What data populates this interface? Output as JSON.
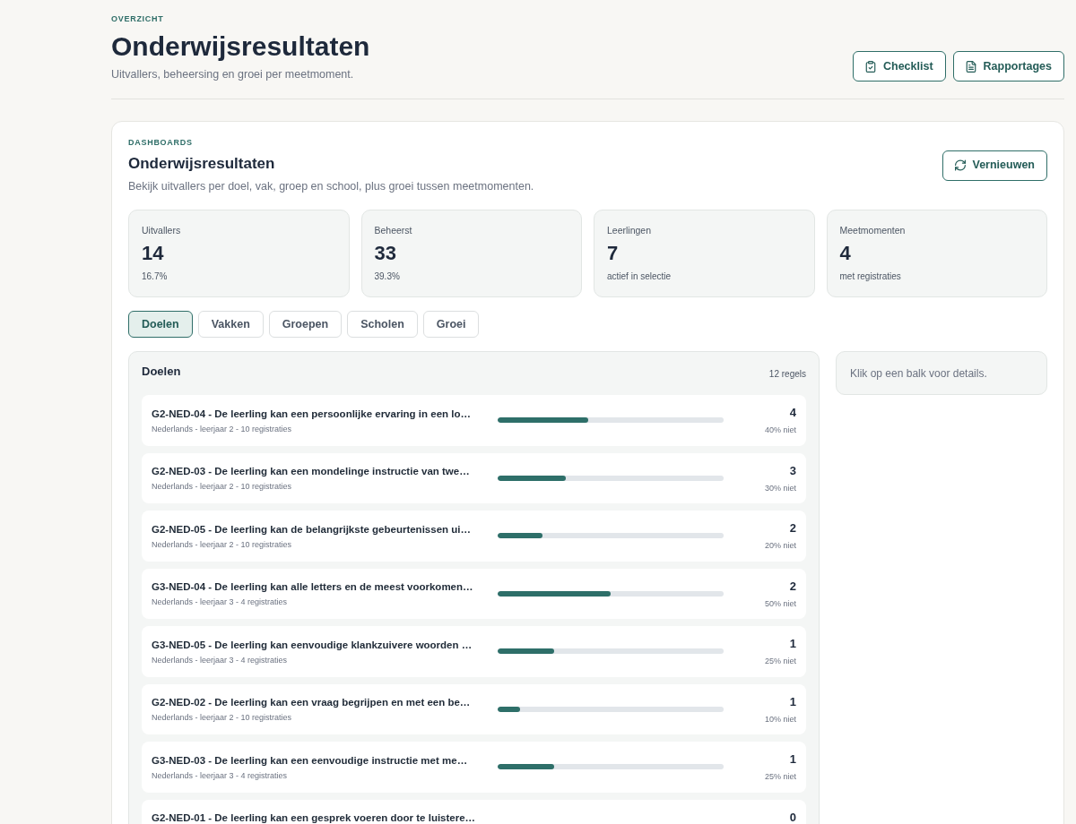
{
  "header": {
    "eyebrow": "OVERZICHT",
    "title": "Onderwijsresultaten",
    "subtitle": "Uitvallers, beheersing en groei per meetmoment.",
    "actions": [
      {
        "label": "Checklist"
      },
      {
        "label": "Rapportages"
      }
    ]
  },
  "dashboard": {
    "eyebrow": "DASHBOARDS",
    "title": "Onderwijsresultaten",
    "description": "Bekijk uitvallers per doel, vak, groep en school, plus groei tussen meetmomenten.",
    "refresh_button": {
      "label": "Vernieuwen"
    }
  },
  "stats": [
    {
      "label": "Uitvallers",
      "value": "14",
      "note": "16.7%"
    },
    {
      "label": "Beheerst",
      "value": "33",
      "note": "39.3%"
    },
    {
      "label": "Leerlingen",
      "value": "7",
      "note": "actief in selectie"
    },
    {
      "label": "Meetmomenten",
      "value": "4",
      "note": "met registraties"
    }
  ],
  "tabs": [
    {
      "label": "Doelen",
      "selected": true
    },
    {
      "label": "Vakken",
      "selected": false
    },
    {
      "label": "Groepen",
      "selected": false
    },
    {
      "label": "Scholen",
      "selected": false
    },
    {
      "label": "Groei",
      "selected": false
    }
  ],
  "list": {
    "title": "Doelen",
    "count": "12 regels",
    "rows": [
      {
        "title": "G2-NED-04 - De leerling kan een persoonlijke ervaring in een lo…",
        "meta": "Nederlands - leerjaar 2 - 10 registraties",
        "level": 0.4,
        "count": "4",
        "share": "40% niet"
      },
      {
        "title": "G2-NED-03 - De leerling kan een mondelinge instructie van twe…",
        "meta": "Nederlands - leerjaar 2 - 10 registraties",
        "level": 0.3,
        "count": "3",
        "share": "30% niet"
      },
      {
        "title": "G2-NED-05 - De leerling kan de belangrijkste gebeurtenissen ui…",
        "meta": "Nederlands - leerjaar 2 - 10 registraties",
        "level": 0.2,
        "count": "2",
        "share": "20% niet"
      },
      {
        "title": "G3-NED-04 - De leerling kan alle letters en de meest voorkomen…",
        "meta": "Nederlands - leerjaar 3 - 4 registraties",
        "level": 0.5,
        "count": "2",
        "share": "50% niet"
      },
      {
        "title": "G3-NED-05 - De leerling kan eenvoudige klankzuivere woorden …",
        "meta": "Nederlands - leerjaar 3 - 4 registraties",
        "level": 0.25,
        "count": "1",
        "share": "25% niet"
      },
      {
        "title": "G2-NED-02 - De leerling kan een vraag begrijpen en met een be…",
        "meta": "Nederlands - leerjaar 2 - 10 registraties",
        "level": 0.1,
        "count": "1",
        "share": "10% niet"
      },
      {
        "title": "G3-NED-03 - De leerling kan een eenvoudige instructie met me…",
        "meta": "Nederlands - leerjaar 3 - 4 registraties",
        "level": 0.25,
        "count": "1",
        "share": "25% niet"
      },
      {
        "title": "G2-NED-01 - De leerling kan een gesprek voeren door te luistere…",
        "count": "0"
      }
    ]
  },
  "details": {
    "hint": "Klik op een balk voor details."
  }
}
